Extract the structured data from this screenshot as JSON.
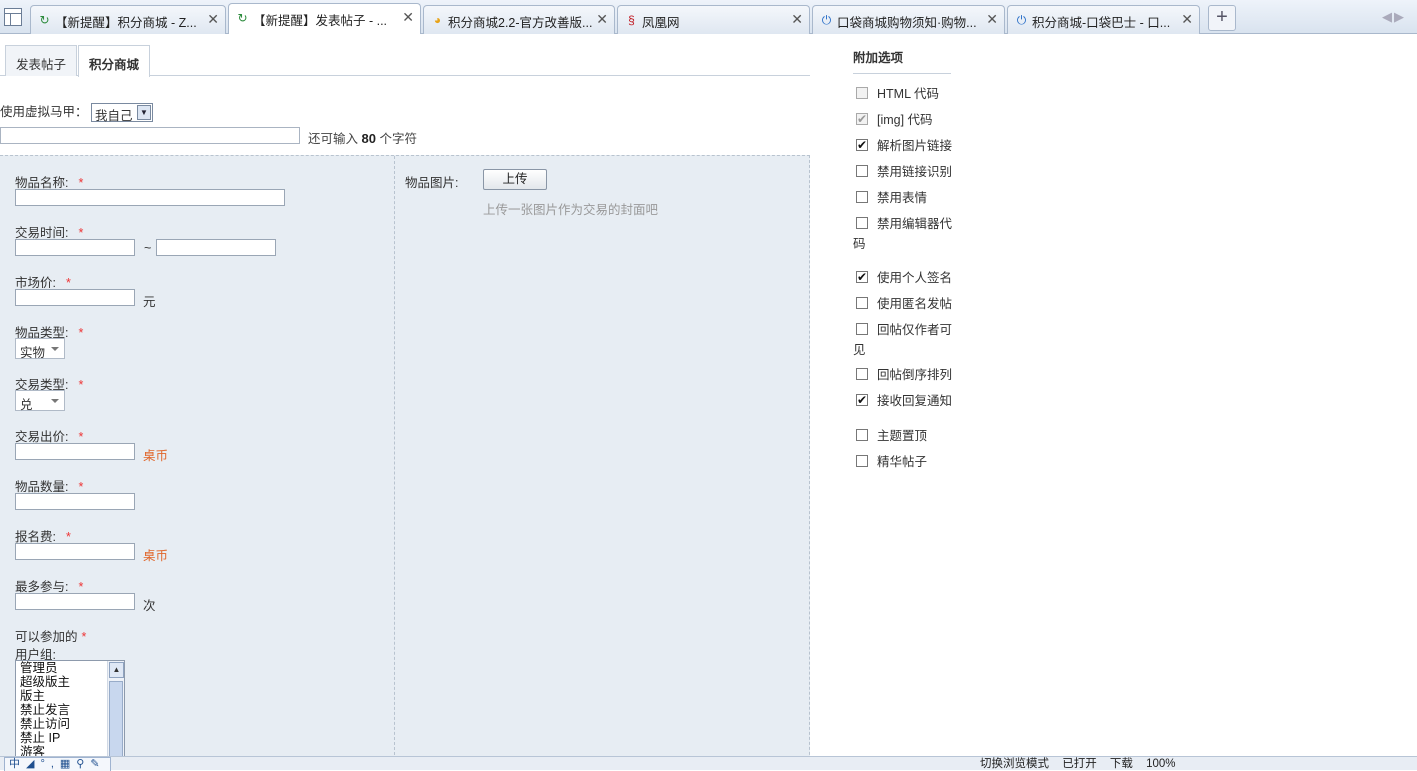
{
  "browser": {
    "tabs": [
      {
        "icon": "page-refresh-icon",
        "title": "【新提醒】积分商城 - Z...",
        "active": false
      },
      {
        "icon": "page-refresh-icon",
        "title": "【新提醒】发表帖子 - ...",
        "active": true
      },
      {
        "icon": "speech-bubble-icon",
        "title": "积分商城2.2-官方改善版...",
        "active": false
      },
      {
        "icon": "phoenix-icon",
        "title": "凤凰网",
        "active": false
      },
      {
        "icon": "power-icon",
        "title": "口袋商城购物须知·购物...",
        "active": false
      },
      {
        "icon": "power-icon",
        "title": "积分商城-口袋巴士 - 口...",
        "active": false
      }
    ],
    "new_tab_label": "+",
    "close_glyph": "✕"
  },
  "form_tabs": [
    "发表帖子",
    "积分商城"
  ],
  "vest": {
    "label": "使用虚拟马甲：",
    "value": "我自己"
  },
  "subject": {
    "remain_prefix": "还可输入",
    "remain_count": "80",
    "remain_suffix": "个字符"
  },
  "fields": {
    "item_name": "物品名称:",
    "trade_time": "交易时间:",
    "tilde": "~",
    "market_price": "市场价:",
    "yuan": "元",
    "item_type": "物品类型:",
    "item_type_value": "实物",
    "trade_type": "交易类型:",
    "trade_type_value": "兑",
    "trade_price": "交易出价:",
    "currency": "桌币",
    "item_count": "物品数量:",
    "signup_fee": "报名费:",
    "max_join": "最多参与:",
    "times": "次",
    "groups_label_1": "可以参加的",
    "groups_label_2": "用户组:",
    "required_mark": "*"
  },
  "user_groups": [
    "管理员",
    "超级版主",
    "版主",
    "禁止发言",
    "禁止访问",
    "禁止 IP",
    "游客"
  ],
  "image": {
    "label": "物品图片:",
    "upload_button": "上传",
    "hint": "上传一张图片作为交易的封面吧"
  },
  "options": {
    "title": "附加选项",
    "items": [
      {
        "label": "HTML 代码",
        "checked": false,
        "disabled": true
      },
      {
        "label": "[img] 代码",
        "checked": true,
        "disabled": true
      },
      {
        "label": "解析图片链接",
        "checked": true,
        "disabled": false
      },
      {
        "label": "禁用链接识别",
        "checked": false,
        "disabled": false
      },
      {
        "label": "禁用表情",
        "checked": false,
        "disabled": false
      },
      {
        "label": "禁用编辑器代码",
        "checked": false,
        "disabled": false
      },
      {
        "label": "使用个人签名",
        "checked": true,
        "disabled": false
      },
      {
        "label": "使用匿名发帖",
        "checked": false,
        "disabled": false
      },
      {
        "label": "回帖仅作者可见",
        "checked": false,
        "disabled": false
      },
      {
        "label": "回帖倒序排列",
        "checked": false,
        "disabled": false
      },
      {
        "label": "接收回复通知",
        "checked": true,
        "disabled": false
      },
      {
        "label": "主题置顶",
        "checked": false,
        "disabled": false
      },
      {
        "label": "精华帖子",
        "checked": false,
        "disabled": false
      }
    ]
  },
  "statusbar": {
    "ime": "中 ◢ °, ▦ ⚲ ✎",
    "items": [
      "切换浏览模式",
      "已打开",
      "下载",
      "100%"
    ]
  }
}
